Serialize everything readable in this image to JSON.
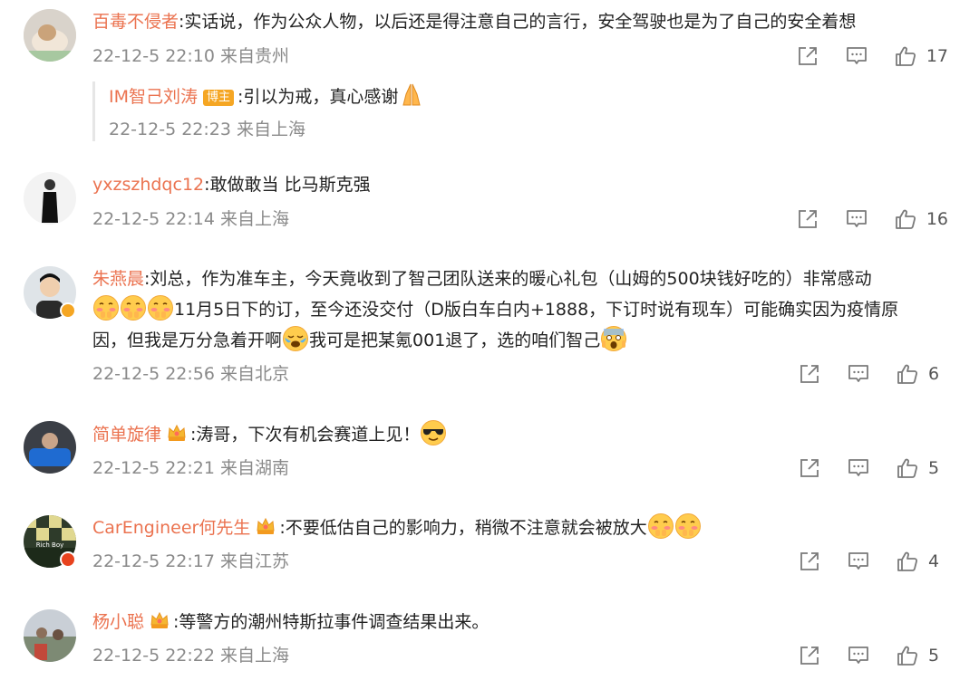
{
  "comments": [
    {
      "user": "百毒不侵者",
      "text": ":实话说，作为公众人物，以后还是得注意自己的言行，安全驾驶也是为了自己的安全着想",
      "time": "22-12-5 22:10",
      "location": "来自贵州",
      "likes": "17",
      "reply": {
        "user": "IM智己刘涛",
        "badge": "博主",
        "text": ":引以为戒，真心感谢",
        "time": "22-12-5 22:23",
        "location": "来自上海"
      }
    },
    {
      "user": "yxzszhdqc12",
      "text": ":敢做敢当 比马斯克强",
      "time": "22-12-5 22:14",
      "location": "来自上海",
      "likes": "16"
    },
    {
      "user": "朱燕晨",
      "text_a": ":刘总，作为准车主，今天竟收到了智己团队送来的暖心礼包（山姆的500块钱好吃的）非常感动",
      "text_b": "11月5日下的订，至今还没交付（D版白车白内+1888，下订时说有现车）可能确实因为疫情原",
      "text_c": "因，但我是万分急着开啊",
      "text_d": "我可是把某氪001退了，选的咱们智己",
      "time": "22-12-5 22:56",
      "location": "来自北京",
      "likes": "6"
    },
    {
      "user": "简单旋律",
      "text": ":涛哥，下次有机会赛道上见！",
      "time": "22-12-5 22:21",
      "location": "来自湖南",
      "likes": "5"
    },
    {
      "user": "CarEngineer何先生",
      "text": ":不要低估自己的影响力，稍微不注意就会被放大",
      "time": "22-12-5 22:17",
      "location": "来自江苏",
      "likes": "4",
      "avatar_text": "Rich Boy"
    },
    {
      "user": "杨小聪",
      "text": ":等警方的潮州特斯拉事件调查结果出来。",
      "time": "22-12-5 22:22",
      "location": "来自上海",
      "likes": "5"
    }
  ],
  "icons": {
    "share": "share-icon",
    "comment": "comment-icon",
    "like": "thumbs-up-icon"
  },
  "colors": {
    "username": "#eb7350",
    "meta": "#8a8a8a",
    "verified": "#f5a623",
    "verified_red": "#e8431e"
  }
}
